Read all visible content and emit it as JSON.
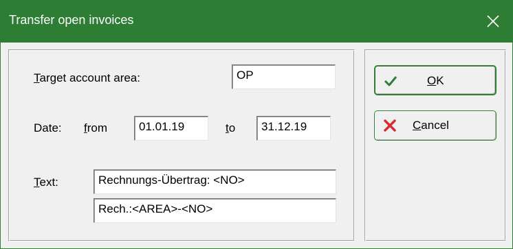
{
  "window": {
    "title": "Transfer open invoices"
  },
  "form": {
    "target_label": "Target account area:",
    "target_value": "OP",
    "date_label": "Date:",
    "from_label": "from",
    "from_value": "01.01.19",
    "to_label": "to",
    "to_value": "31.12.19",
    "text_label": "Text:",
    "text_line1": "Rechnungs-Übertrag: <NO>",
    "text_line2": "Rech.:<AREA>-<NO>"
  },
  "buttons": {
    "ok_label": "OK",
    "cancel_label": "Cancel"
  },
  "icons": {
    "close": "close-icon",
    "ok": "checkmark-icon",
    "cancel": "cross-icon"
  },
  "colors": {
    "titlebar": "#2e7d35",
    "ok_check": "#2e7d35",
    "cancel_cross": "#d32f2f"
  }
}
